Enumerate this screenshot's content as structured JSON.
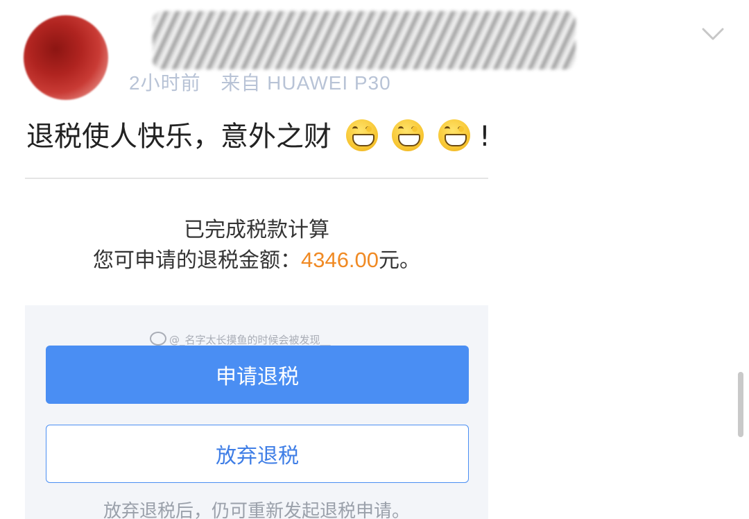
{
  "post": {
    "time": "2小时前",
    "source": "来自 HUAWEI P30",
    "text": "退税使人快乐，意外之财",
    "emoji_icons": [
      "grin-emoji",
      "grin-emoji",
      "grin-emoji"
    ],
    "suffix": "!"
  },
  "shared_image": {
    "calc_status": "已完成税款计算",
    "refund_label": "您可申请的退税金额：",
    "refund_amount": "4346.00",
    "refund_unit": "元。",
    "watermark": "@_名字太长摸鱼的时候会被发现__",
    "apply_button": "申请退税",
    "abandon_button": "放弃退税",
    "footnote": "放弃退税后，仍可重新发起退税申请。",
    "accent_color": "#4a8ef3",
    "amount_color": "#f08a24"
  },
  "icons": {
    "menu": "chevron-down-icon",
    "watermark": "weibo-icon"
  }
}
